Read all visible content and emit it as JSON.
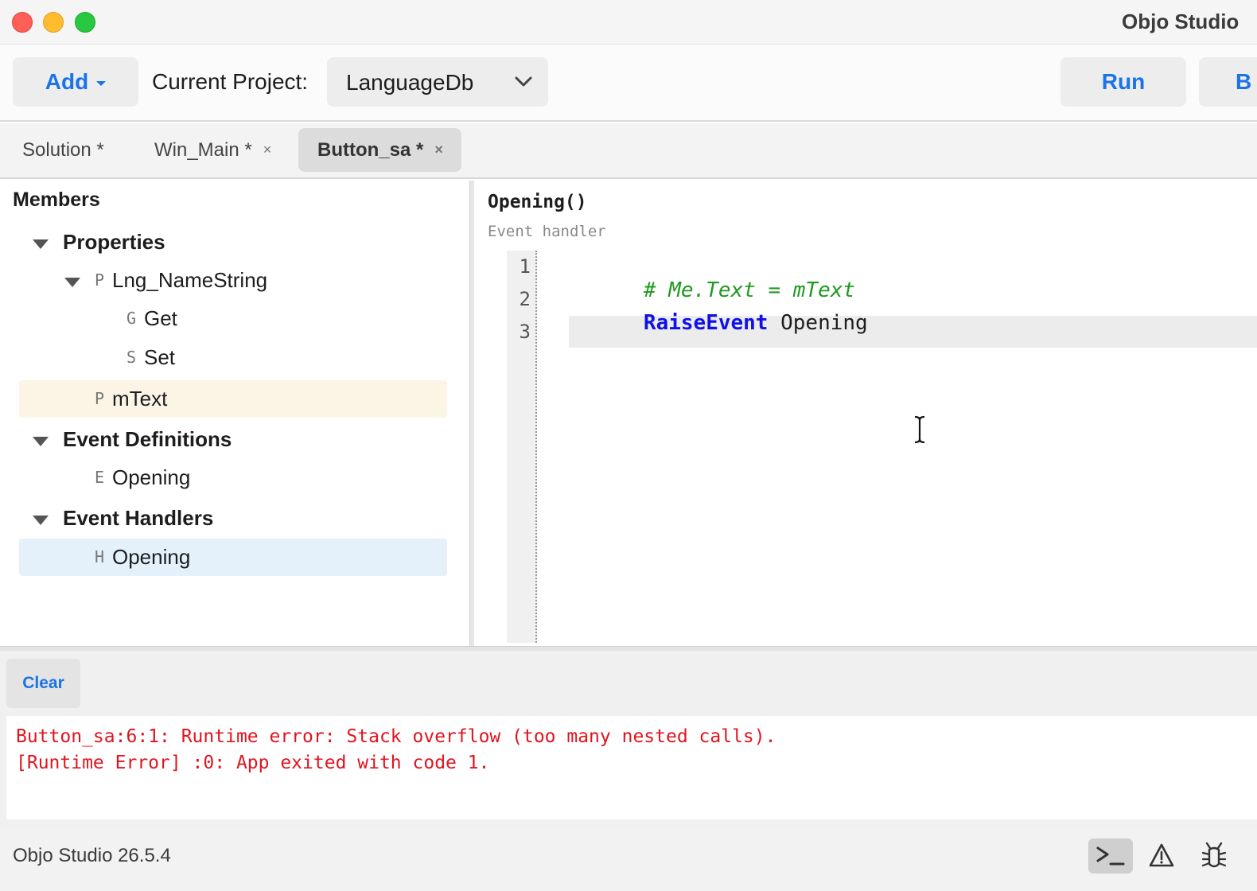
{
  "window": {
    "title": "Objo Studio"
  },
  "toolbar": {
    "add_label": "Add",
    "project_label": "Current Project:",
    "project_value": "LanguageDb",
    "run_label": "Run",
    "b_label": "B"
  },
  "tabs": [
    {
      "label": "Solution *",
      "closable": false,
      "active": false
    },
    {
      "label": "Win_Main *",
      "closable": true,
      "active": false
    },
    {
      "label": "Button_sa *",
      "closable": true,
      "active": true
    }
  ],
  "tab_close_glyph": "×",
  "members": {
    "title": "Members",
    "properties_group": "Properties",
    "lng_kind": "P",
    "lng_label": "Lng_NameString",
    "get_kind": "G",
    "get_label": "Get",
    "set_kind": "S",
    "set_label": "Set",
    "mtext_kind": "P",
    "mtext_label": "mText",
    "event_defs_group": "Event Definitions",
    "evdef_kind": "E",
    "evdef_label": "Opening",
    "event_handlers_group": "Event Handlers",
    "handler_kind": "H",
    "handler_label": "Opening"
  },
  "editor": {
    "signature": "Opening()",
    "subtitle": "Event handler",
    "line_numbers": [
      "1",
      "2",
      "3"
    ],
    "line1_comment": "# Me.Text = mText",
    "line2_keyword": "RaiseEvent",
    "line2_rest": " Opening"
  },
  "console": {
    "clear_label": "Clear",
    "line1": "Button_sa:6:1: Runtime error: Stack overflow (too many nested calls).",
    "line2": "[Runtime Error] :0: App exited with code 1."
  },
  "status": {
    "version": "Objo Studio 26.5.4",
    "icons": [
      "terminal-icon",
      "warning-icon",
      "bug-icon"
    ]
  },
  "colors": {
    "accent": "#1a73e8",
    "error": "#e0141e",
    "keyword": "#1010e8",
    "comment": "#1f9a1f",
    "selected_yellow": "#fcf5e6",
    "selected_blue": "#e4f1fb"
  }
}
